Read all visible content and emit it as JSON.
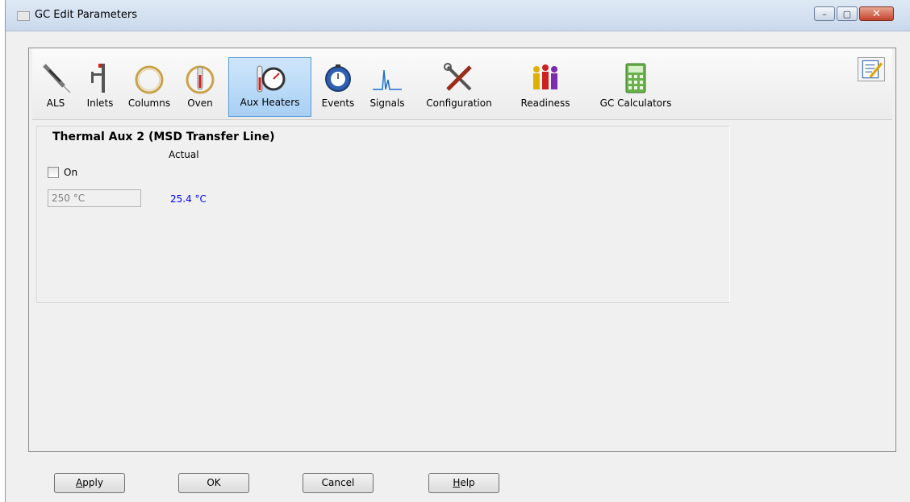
{
  "window": {
    "title": "GC Edit Parameters",
    "controls": {
      "minimize": "–",
      "maximize": "▢",
      "close": "✕"
    }
  },
  "toolbar": {
    "items": [
      {
        "label": "ALS",
        "icon": "syringe-icon"
      },
      {
        "label": "Inlets",
        "icon": "inlet-icon"
      },
      {
        "label": "Columns",
        "icon": "column-coil-icon"
      },
      {
        "label": "Oven",
        "icon": "oven-icon"
      },
      {
        "label": "Aux Heaters",
        "icon": "aux-heater-gauge-icon",
        "selected": true
      },
      {
        "label": "Events",
        "icon": "stopwatch-icon"
      },
      {
        "label": "Signals",
        "icon": "signal-peak-icon"
      },
      {
        "label": "Configuration",
        "icon": "tools-icon"
      },
      {
        "label": "Readiness",
        "icon": "people-icon"
      },
      {
        "label": "GC Calculators",
        "icon": "calculator-icon"
      }
    ],
    "edit_icon": "edit-notes-icon"
  },
  "panel": {
    "title": "Thermal Aux 2 (MSD Transfer Line)",
    "actual_label": "Actual",
    "on_label": "On",
    "on_checked": false,
    "setpoint": "250 °C",
    "actual_value": "25.4 °C"
  },
  "buttons": {
    "apply": {
      "label": "Apply",
      "mnemonic": "A",
      "rest": "pply"
    },
    "ok": {
      "label": "OK"
    },
    "cancel": {
      "label": "Cancel"
    },
    "help": {
      "label": "Help",
      "mnemonic": "H",
      "rest": "elp"
    }
  },
  "colors": {
    "accent_selected": "#a8d0f4",
    "actual_value": "#0000ff"
  }
}
